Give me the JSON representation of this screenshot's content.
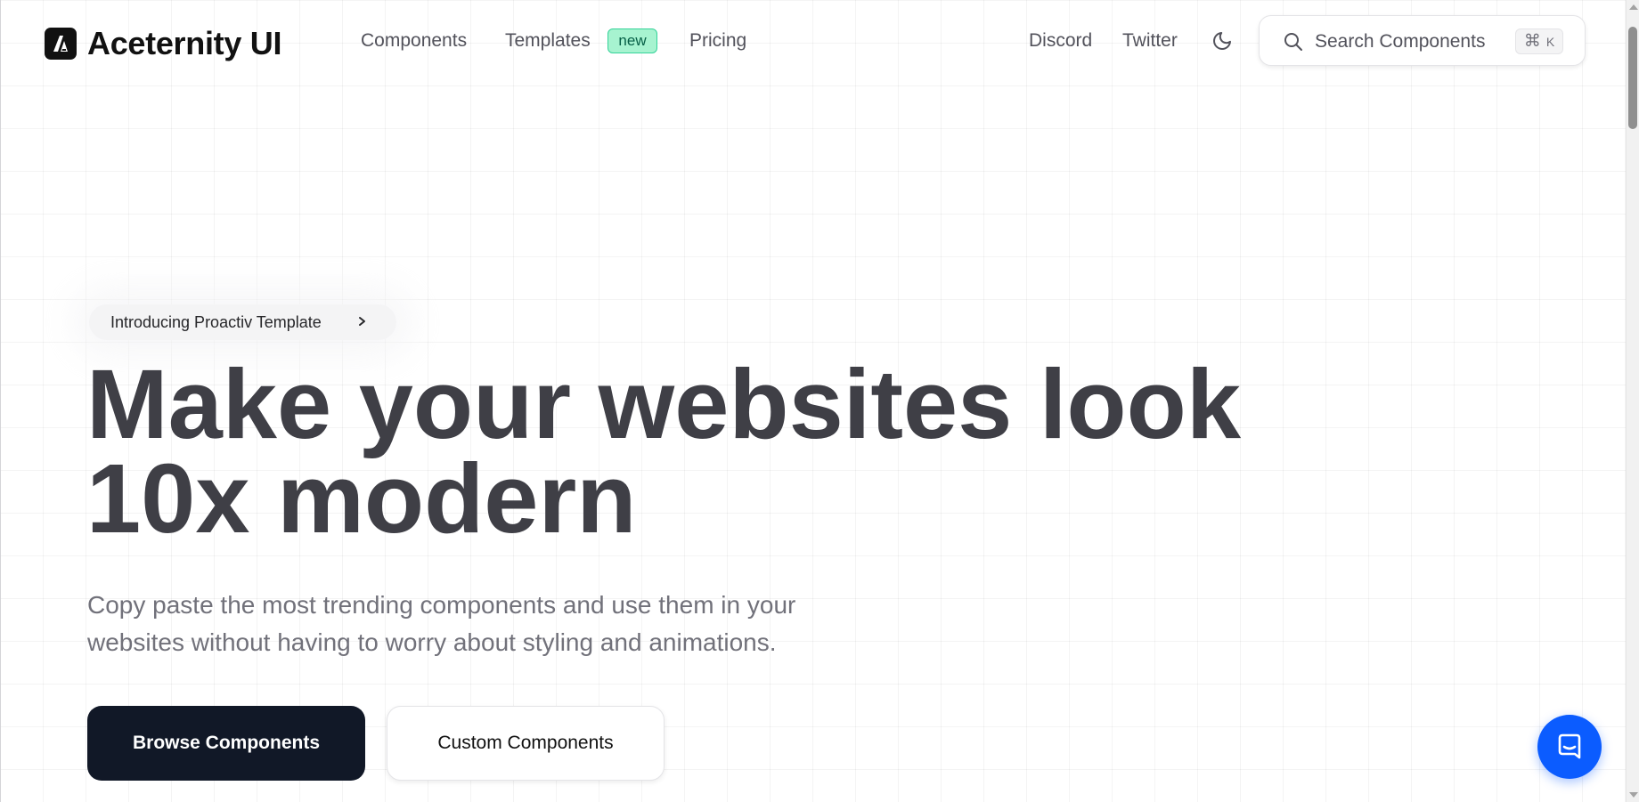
{
  "navbar": {
    "brand": "Aceternity UI",
    "links": {
      "components": "Components",
      "templates": "Templates",
      "templates_badge": "new",
      "pricing": "Pricing",
      "discord": "Discord",
      "twitter": "Twitter"
    },
    "theme_toggle_icon": "moon-icon",
    "search": {
      "placeholder": "Search Components",
      "shortcut_symbol": "⌘",
      "shortcut_key": "K"
    }
  },
  "hero": {
    "announcement": "Introducing Proactiv Template",
    "announcement_icon": "chevron-right-icon",
    "title_line_1": "Make your websites look",
    "title_line_2": "10x modern",
    "subtitle_line_1": "Copy paste the most trending components and use them in your",
    "subtitle_line_2": "websites without having to worry about styling and animations.",
    "primary_cta": "Browse Components",
    "secondary_cta": "Custom Components"
  },
  "chat_widget": {
    "icon": "chat-bubble-icon"
  },
  "colors": {
    "primary_button": "#111827",
    "badge_bg": "#a7f3d0",
    "badge_border": "#34d399",
    "chat_launcher": "#0b5cff",
    "heading": "#3f3f46",
    "muted_text": "#71717a"
  }
}
